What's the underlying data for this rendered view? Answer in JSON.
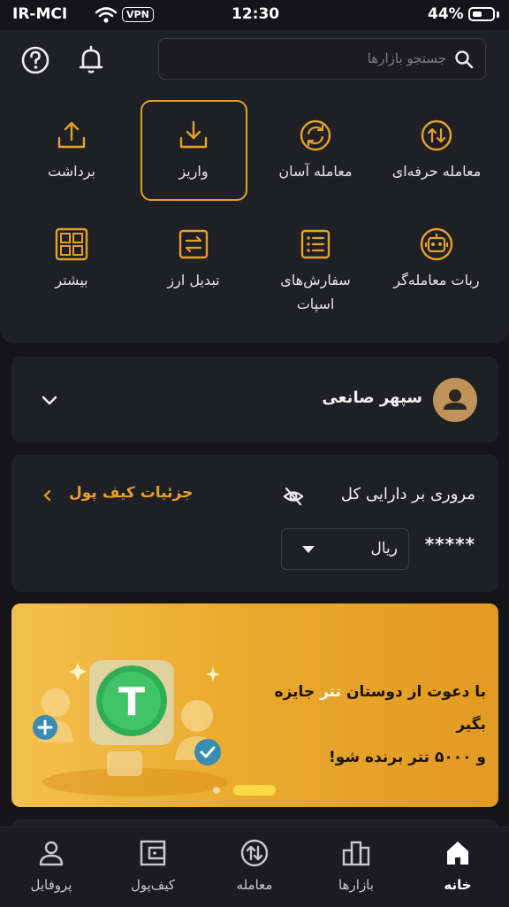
{
  "status_bar": {
    "carrier": "IR-MCI",
    "vpn": "VPN",
    "time": "12:30",
    "battery": "44%",
    "battery_level": 0.44
  },
  "search": {
    "placeholder": "جستجو بازارها"
  },
  "actions": [
    {
      "label": "معامله حرفه‌ای",
      "icon": "pro-trade-icon"
    },
    {
      "label": "معامله آسان",
      "icon": "easy-trade-icon"
    },
    {
      "label": "واریز",
      "icon": "deposit-icon"
    },
    {
      "label": "برداشت",
      "icon": "withdraw-icon"
    },
    {
      "label": "ربات معامله‌گر",
      "icon": "robot-icon"
    },
    {
      "label": "سفارش‌های",
      "label2": "اسپات",
      "icon": "orders-icon"
    },
    {
      "label": "تبدیل ارز",
      "icon": "convert-icon"
    },
    {
      "label": "بیشتر",
      "icon": "more-grid-icon"
    }
  ],
  "user": {
    "name": "سپهر صانعی"
  },
  "assets": {
    "title": "مروری بر دارایی کل",
    "wallet_link": "جزئیات کیف پول",
    "masked_balance": "*****",
    "currency": "ریال"
  },
  "banner": {
    "line1_prefix": "با دعوت از دوستان",
    "highlight": "تتر",
    "line1_suffix": "جایزه بگیر",
    "line2": "و ۵۰۰۰ تتر برنده شو!",
    "logo_text": "T"
  },
  "nav": [
    {
      "label": "خانه",
      "icon": "home-icon",
      "active": true
    },
    {
      "label": "بازارها",
      "icon": "markets-icon"
    },
    {
      "label": "معامله",
      "icon": "trade-icon"
    },
    {
      "label": "کیف‌پول",
      "icon": "wallet-icon"
    },
    {
      "label": "پروفایل",
      "icon": "profile-icon"
    }
  ],
  "colors": {
    "accent": "#e5a127",
    "background": "#141419",
    "card": "#1f1f26"
  }
}
